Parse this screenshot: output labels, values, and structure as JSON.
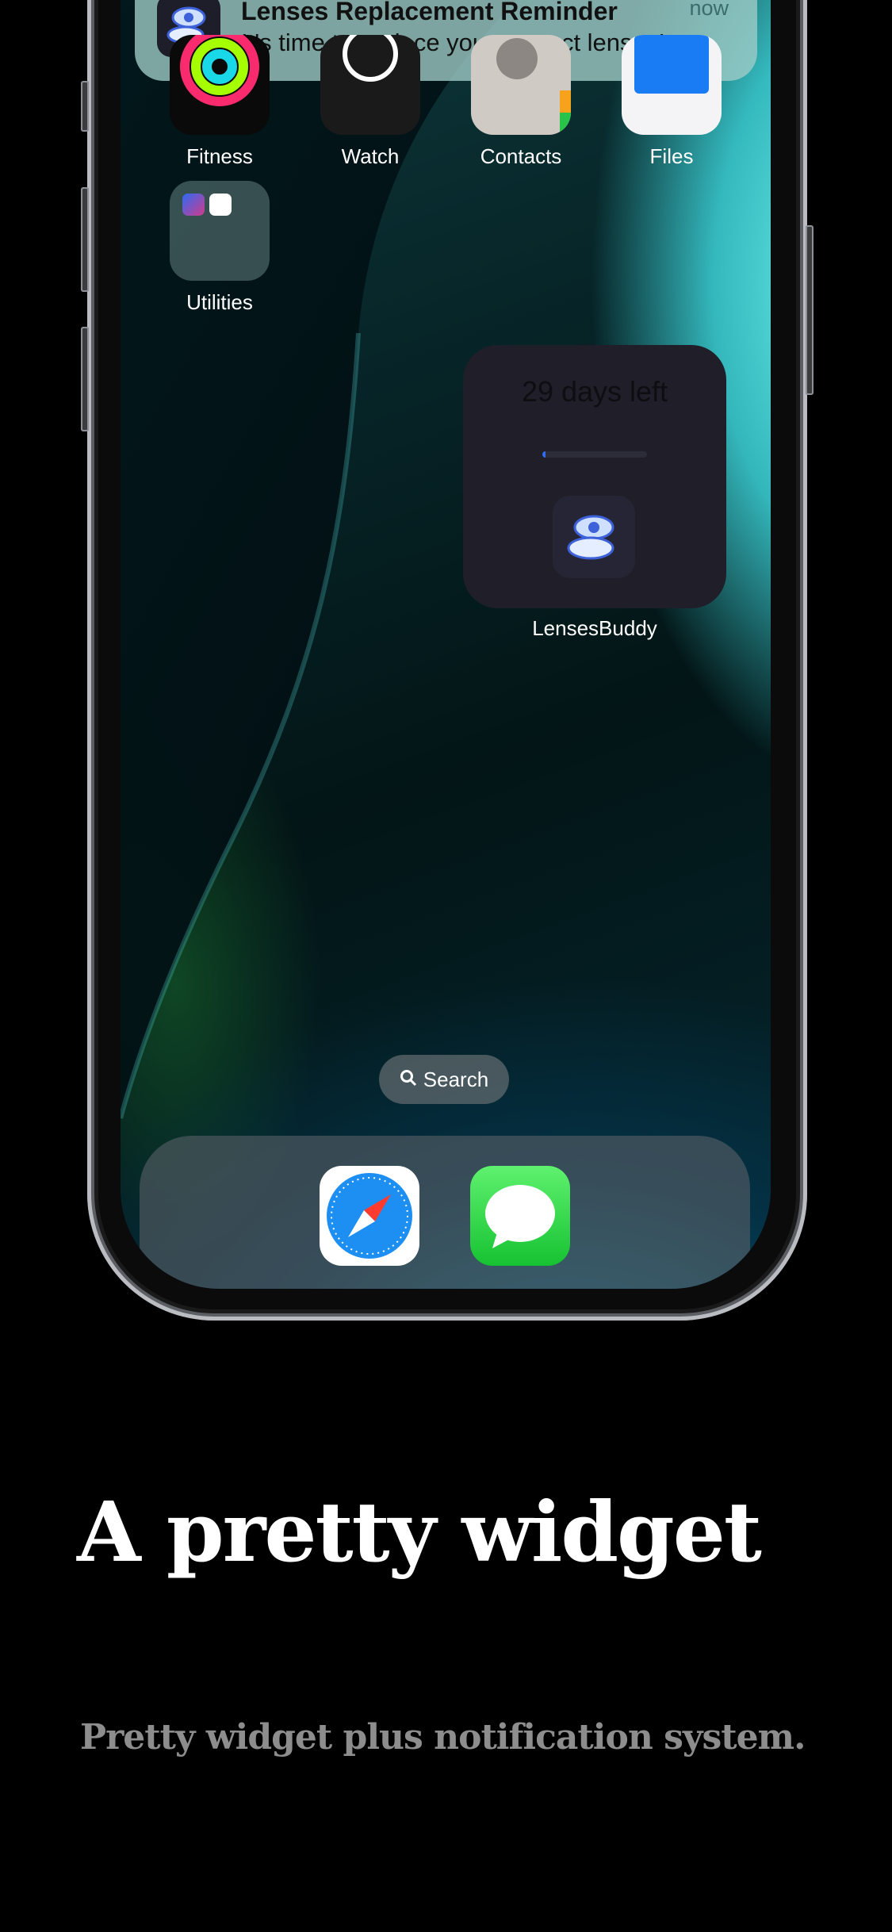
{
  "notification": {
    "title": "Lenses Replacement Reminder",
    "body": "It's time to replace your contact lenses!",
    "time": "now",
    "icon": "lens-eye-icon"
  },
  "apps_row": [
    {
      "label": "Fitness",
      "icon": "fitness-rings-icon"
    },
    {
      "label": "Watch",
      "icon": "watch-icon"
    },
    {
      "label": "Contacts",
      "icon": "contacts-icon"
    },
    {
      "label": "Files",
      "icon": "files-folder-icon"
    }
  ],
  "folder": {
    "label": "Utilities",
    "icon": "utilities-folder-icon"
  },
  "widget": {
    "days_left": "29 days left",
    "progress": 0.03,
    "label": "LensesBuddy",
    "icon": "lens-eye-icon",
    "accent": "#2f6cf0"
  },
  "search": {
    "label": "Search",
    "icon": "search-icon"
  },
  "dock": [
    {
      "name": "Safari",
      "icon": "safari-compass-icon"
    },
    {
      "name": "Messages",
      "icon": "messages-bubble-icon"
    }
  ],
  "headline": "A pretty widget",
  "subheadline": "Pretty widget plus notification system."
}
